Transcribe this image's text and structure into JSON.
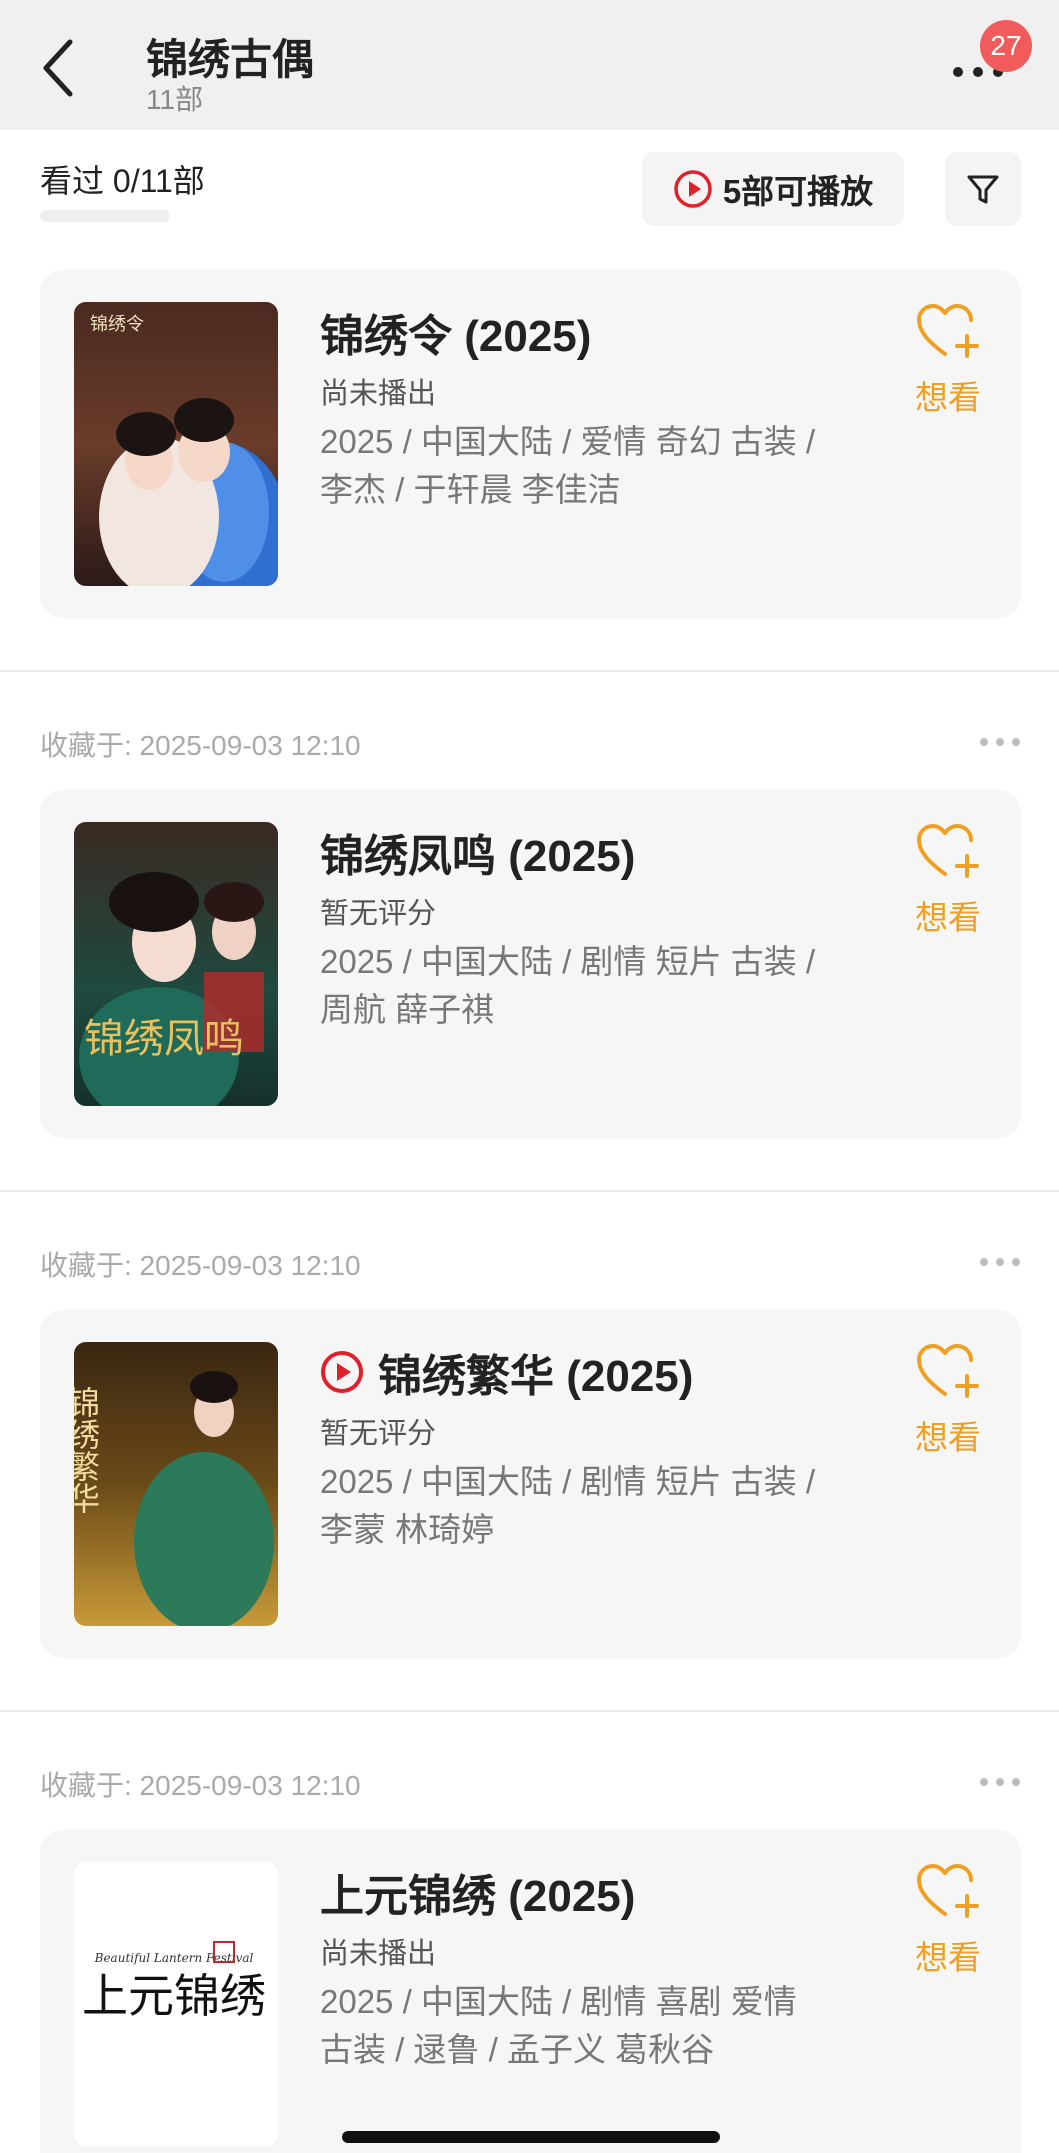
{
  "header": {
    "title": "锦绣古偶",
    "subtitle": "11部",
    "notification_count": "27"
  },
  "toolbar": {
    "watched_label": "看过 0/11部",
    "watched_progress": 0,
    "play_label": "5部可播放"
  },
  "accent_color": "#f0a020",
  "play_icon_color": "#e0202a",
  "items": [
    {
      "saved_at": "",
      "title": "锦绣令 (2025)",
      "playable": false,
      "status": "尚未播出",
      "meta": "2025 / 中国大陆 / 爱情 奇幻 古装 / 李杰 / 于轩晨 李佳洁",
      "want_label": "想看",
      "poster_text": "锦绣令"
    },
    {
      "saved_at": "收藏于: 2025-09-03 12:10",
      "title": "锦绣凤鸣 (2025)",
      "playable": false,
      "status": "暂无评分",
      "meta": "2025 / 中国大陆 / 剧情 短片 古装 / 周航 薛子祺",
      "want_label": "想看",
      "poster_text": "锦绣凤鸣"
    },
    {
      "saved_at": "收藏于: 2025-09-03 12:10",
      "title": "锦绣繁华 (2025)",
      "playable": true,
      "status": "暂无评分",
      "meta": "2025 / 中国大陆 / 剧情 短片 古装 / 李蒙 林琦婷",
      "want_label": "想看",
      "poster_text": "锦绣繁华"
    },
    {
      "saved_at": "收藏于: 2025-09-03 12:10",
      "title": "上元锦绣 (2025)",
      "playable": false,
      "status": "尚未播出",
      "meta": "2025 / 中国大陆 / 剧情 喜剧 爱情 古装 / 逯鲁 / 孟子义 葛秋谷",
      "want_label": "想看",
      "poster_text": "上元锦绣",
      "poster_subtext": "Beautiful Lantern Festival"
    }
  ]
}
